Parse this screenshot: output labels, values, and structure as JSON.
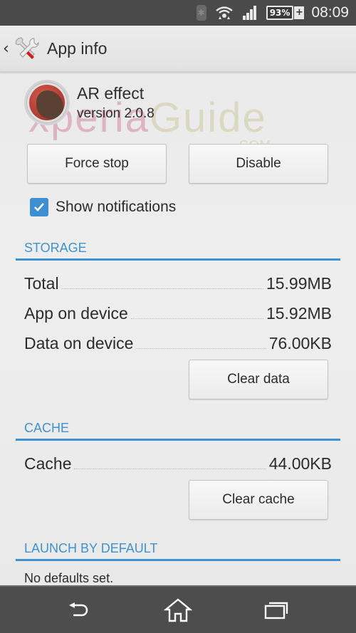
{
  "status_bar": {
    "bluetooth_icon": "bluetooth-icon",
    "wifi_icon": "wifi-icon",
    "signal_icon": "signal-icon",
    "battery_percent": "93%",
    "battery_charging_symbol": "+",
    "time": "08:09"
  },
  "action_bar": {
    "back_symbol": "‹",
    "title": "App info"
  },
  "app": {
    "name": "AR effect",
    "version": "version 2.0.8"
  },
  "watermark": {
    "part1": "xperia",
    "part2": "Guide",
    "suffix": ".COM"
  },
  "buttons": {
    "force_stop": "Force stop",
    "disable": "Disable",
    "clear_data": "Clear data",
    "clear_cache": "Clear cache"
  },
  "show_notifications": {
    "label": "Show notifications",
    "checked": true
  },
  "storage": {
    "header": "STORAGE",
    "rows": [
      {
        "label": "Total",
        "value": "15.99MB"
      },
      {
        "label": "App on device",
        "value": "15.92MB"
      },
      {
        "label": "Data on device",
        "value": "76.00KB"
      }
    ]
  },
  "cache": {
    "header": "CACHE",
    "rows": [
      {
        "label": "Cache",
        "value": "44.00KB"
      }
    ]
  },
  "launch_by_default": {
    "header": "LAUNCH BY DEFAULT",
    "text": "No defaults set."
  },
  "colors": {
    "accent": "#3f92d2",
    "checkbox": "#3d8fd1",
    "status_bar": "#4a4a4a",
    "nav_bar": "#4d4d4d"
  }
}
